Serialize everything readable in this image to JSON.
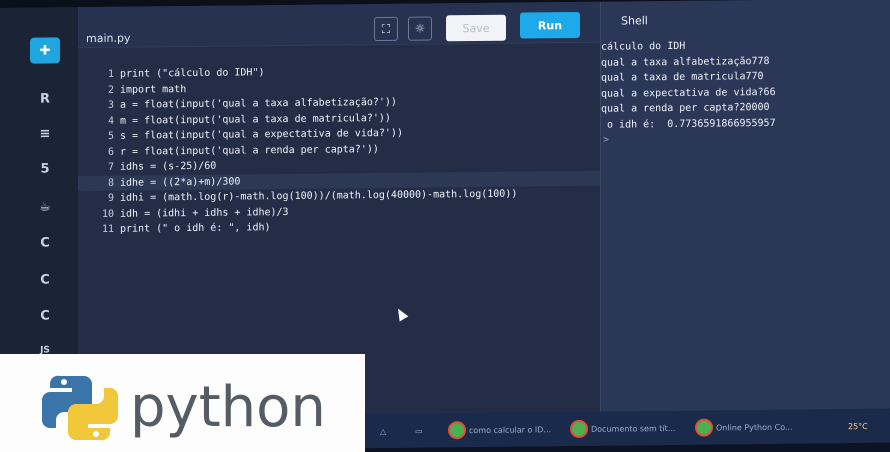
{
  "editor": {
    "file_tab": "main.py",
    "save_label": "Save",
    "run_label": "Run",
    "lines": [
      {
        "n": "1",
        "text": "print (\"cálculo do IDH\")"
      },
      {
        "n": "2",
        "text": "import math"
      },
      {
        "n": "3",
        "text": "a = float(input('qual a taxa alfabetização?'))"
      },
      {
        "n": "4",
        "text": "m = float(input('qual a taxa de matricula?'))"
      },
      {
        "n": "5",
        "text": "s = float(input('qual a expectativa de vida?'))"
      },
      {
        "n": "6",
        "text": "r = float(input('qual a renda per capta?'))"
      },
      {
        "n": "7",
        "text": "idhs = (s-25)/60"
      },
      {
        "n": "8",
        "text": "idhe = ((2*a)+m)/300"
      },
      {
        "n": "9",
        "text": "idhi = (math.log(r)-math.log(100))/(math.log(40000)-math.log(100))"
      },
      {
        "n": "10",
        "text": "idh = (idhi + idhs + idhe)/3"
      },
      {
        "n": "11",
        "text": "print (\" o idh é: \", idh)"
      }
    ]
  },
  "sidebar": {
    "items": [
      {
        "name": "python-icon",
        "glyph": "✚",
        "active": true
      },
      {
        "name": "r-icon",
        "glyph": "R"
      },
      {
        "name": "database-icon",
        "glyph": "≡"
      },
      {
        "name": "html5-icon",
        "glyph": "5"
      },
      {
        "name": "java-icon",
        "glyph": "☕"
      },
      {
        "name": "c-icon",
        "glyph": "C"
      },
      {
        "name": "cpp-icon",
        "glyph": "C"
      },
      {
        "name": "csharp-icon",
        "glyph": "C"
      },
      {
        "name": "javascript-icon",
        "glyph": "JS"
      }
    ]
  },
  "shell": {
    "title": "Shell",
    "output": [
      "cálculo do IDH",
      "qual a taxa alfabetização778",
      "qual a taxa de matricula770",
      "qual a expectativa de vida?66",
      "qual a renda per capta?20000",
      " o idh é:  0.7736591866955957"
    ],
    "prompt": ">"
  },
  "taskbar": {
    "items": [
      "como calcular o ID...",
      "Documento sem tít...",
      "Online Python Co..."
    ],
    "temperature": "25°C"
  },
  "logo": {
    "text": "python"
  },
  "colors": {
    "accent": "#1da9ea",
    "editor_bg": "#232e46",
    "shell_bg": "#2a3757"
  }
}
